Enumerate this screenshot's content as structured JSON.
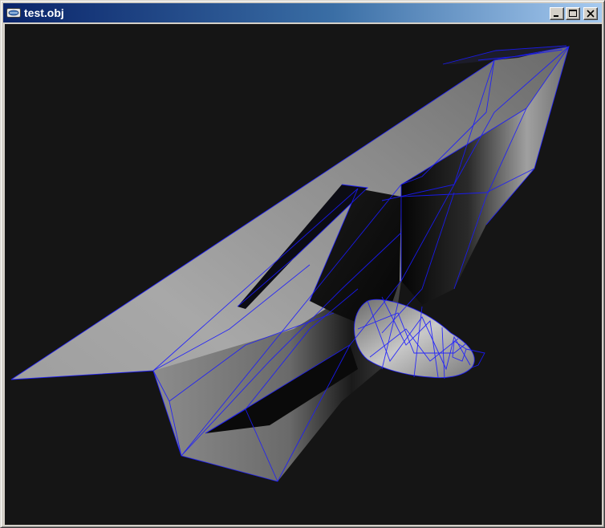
{
  "window": {
    "title": "test.obj",
    "app_icon": "obj-viewer-icon",
    "controls": {
      "minimize_icon": "minimize-icon",
      "maximize_icon": "maximize-icon",
      "close_icon": "close-icon"
    }
  },
  "viewport": {
    "background_color": "#151515",
    "wireframe_color": "#1a1aff",
    "model": "airplane-mesh"
  }
}
